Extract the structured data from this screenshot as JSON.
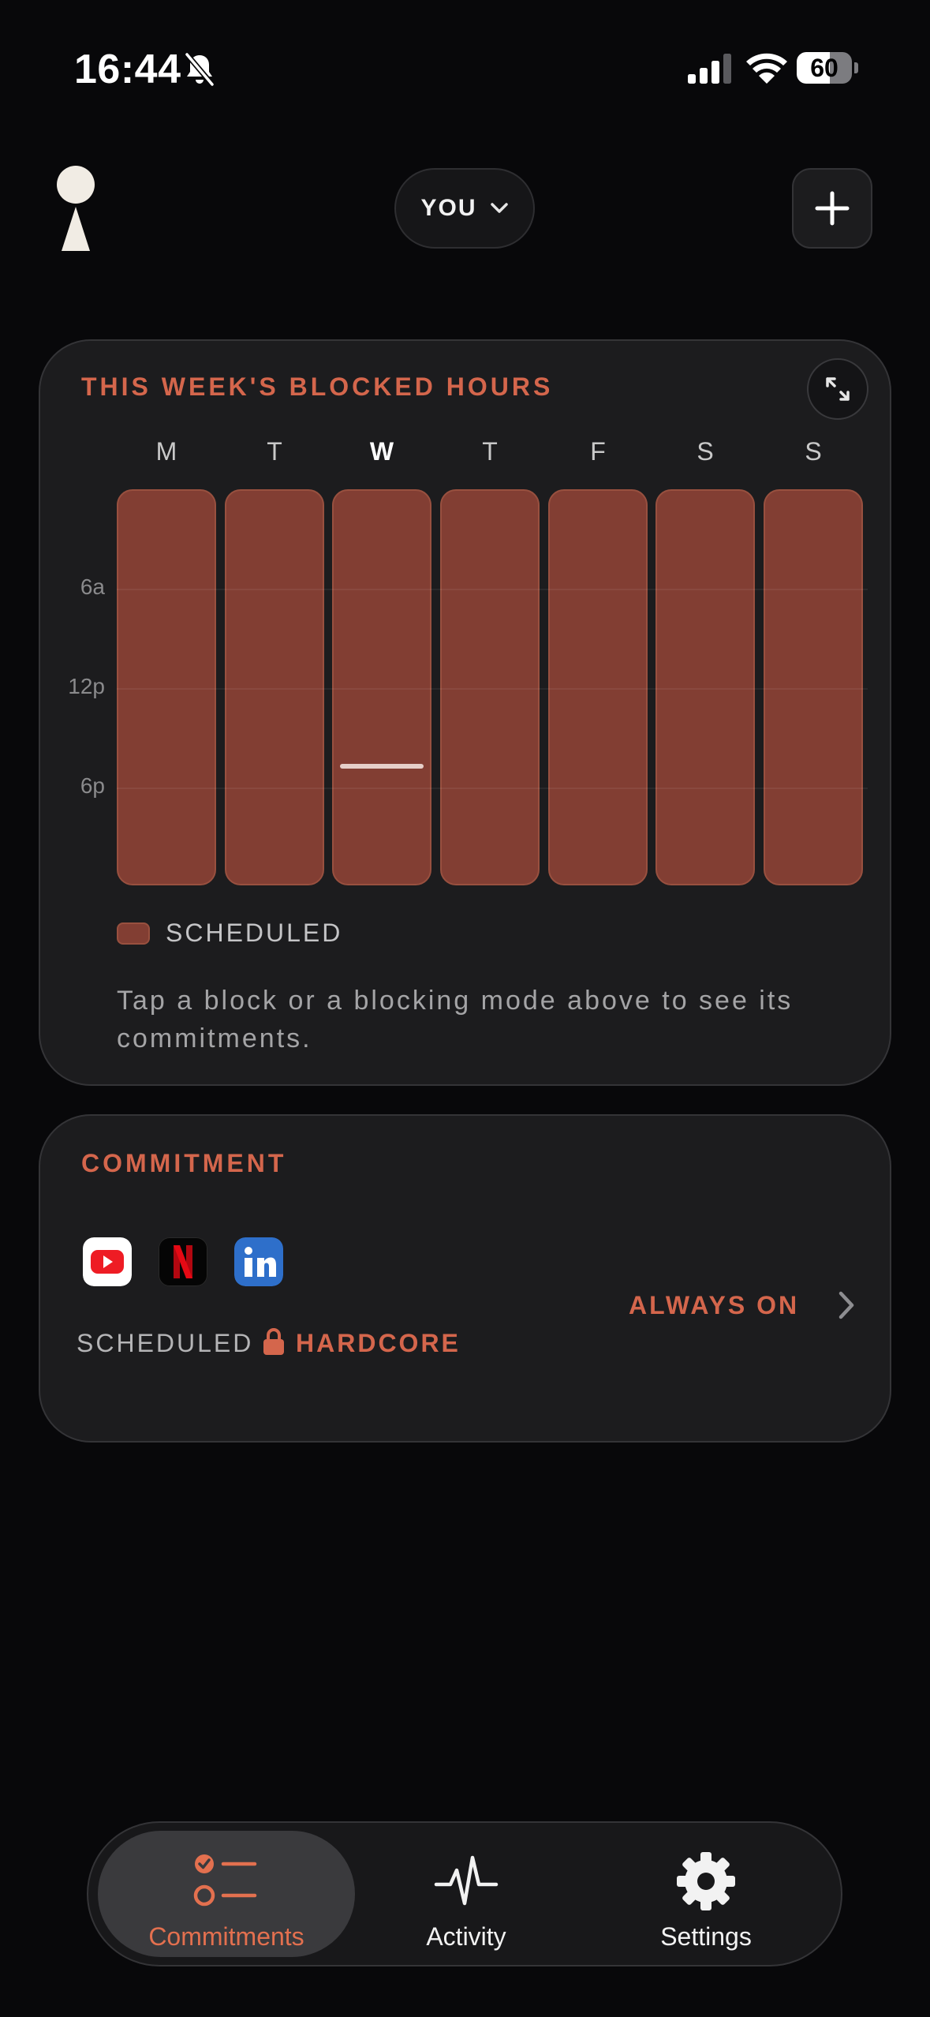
{
  "status_bar": {
    "time": "16:44",
    "battery_level": "60",
    "battery_fraction": 0.6
  },
  "header": {
    "user_selector_label": "YOU"
  },
  "weekly_card": {
    "title": "THIS WEEK'S BLOCKED HOURS",
    "days": [
      "M",
      "T",
      "W",
      "T",
      "F",
      "S",
      "S"
    ],
    "current_day_index": 2,
    "hour_labels": [
      "6a",
      "12p",
      "6p"
    ],
    "current_time_fraction": 0.69,
    "legend_label": "SCHEDULED",
    "hint": "Tap a block or a blocking mode above to see its commitments.",
    "colors": {
      "scheduled": "#823e33",
      "accent": "#d4664c"
    }
  },
  "commitment_card": {
    "title": "COMMITMENT",
    "apps": [
      "youtube-icon",
      "netflix-icon",
      "linkedin-icon"
    ],
    "mode_label": "SCHEDULED",
    "strictness_label": "HARDCORE",
    "schedule_label": "ALWAYS ON"
  },
  "tab_bar": {
    "tabs": [
      {
        "label": "Commitments",
        "icon": "checklist-icon",
        "active": true
      },
      {
        "label": "Activity",
        "icon": "pulse-icon",
        "active": false
      },
      {
        "label": "Settings",
        "icon": "gear-icon",
        "active": false
      }
    ]
  }
}
